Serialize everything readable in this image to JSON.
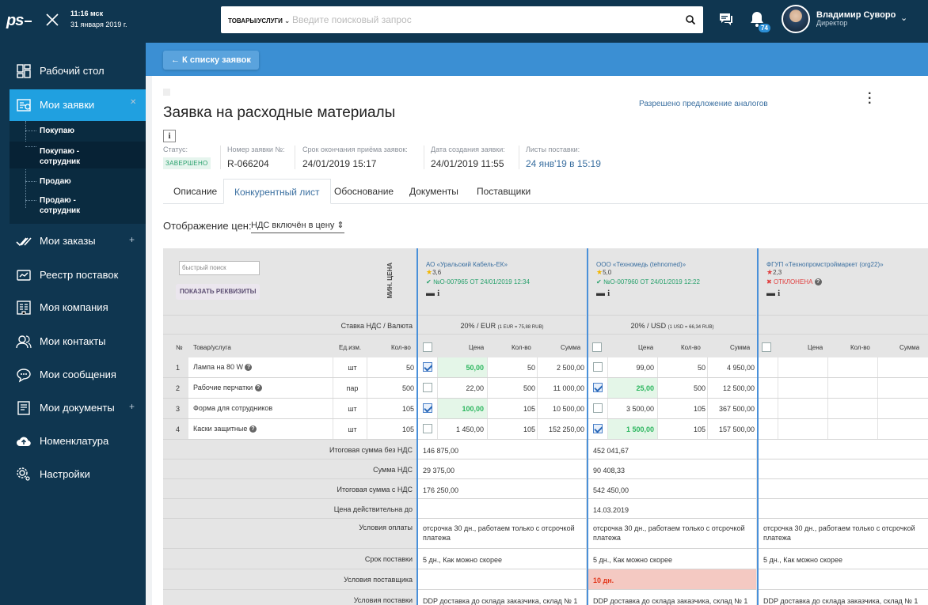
{
  "topbar": {
    "logo": "ps",
    "time": "11:16 мск",
    "date": "31 января 2019 г.",
    "search_category": "ТОВАРЫ/УСЛУГИ",
    "search_placeholder": "Введите поисковый запрос",
    "notif_count": "74",
    "user_name": "Владимир Суворов",
    "user_role": "Директор"
  },
  "sidebar": {
    "items": [
      {
        "label": "Рабочий стол",
        "icon": "dashboard-icon"
      },
      {
        "label": "Мои заявки",
        "icon": "requests-icon",
        "active": true
      },
      {
        "label": "Мои заказы",
        "icon": "orders-icon"
      },
      {
        "label": "Реестр поставок",
        "icon": "registry-icon"
      },
      {
        "label": "Моя компания",
        "icon": "company-icon"
      },
      {
        "label": "Мои контакты",
        "icon": "contacts-icon"
      },
      {
        "label": "Мои сообщения",
        "icon": "messages-icon"
      },
      {
        "label": "Мои документы",
        "icon": "documents-icon"
      },
      {
        "label": "Номенклатура",
        "icon": "cloud-upload-icon"
      },
      {
        "label": "Настройки",
        "icon": "settings-icon"
      }
    ],
    "subitems": [
      "Покупаю",
      "Покупаю -\nсотрудник",
      "Продаю",
      "Продаю -\nсотрудник"
    ]
  },
  "back_label": "← К списку заявок",
  "page": {
    "title": "Заявка на расходные материалы",
    "analogs": "Разрешено предложение аналогов",
    "info_btn": "i",
    "status_label": "Статус:",
    "status_value": "ЗАВЕРШЕНО",
    "number_label": "Номер заявки №:",
    "number_value": "R-066204",
    "deadline_label": "Срок окончания приёма заявок:",
    "deadline_value": "24/01/2019 15:17",
    "created_label": "Дата создания заявки:",
    "created_value": "24/01/2019 11:55",
    "sheets_label": "Листы поставки:",
    "sheets_value": "24 янв'19 в 15:19"
  },
  "tabs": [
    "Описание",
    "Конкурентный лист",
    "Обоснование",
    "Документы",
    "Поставщики"
  ],
  "price_display_label": "Отображение цен:",
  "price_display_value": "НДС включён в цену ⇕",
  "table": {
    "quick_search_placeholder": "быстрый поиск",
    "show_details": "ПОКАЗАТЬ РЕКВИЗИТЫ",
    "min_price_label": "МИН. ЦЕНА",
    "vat_currency_label": "Ставка НДС / Валюта",
    "headers": {
      "num": "№",
      "product": "Товар/услуга",
      "unit": "Ед.изм.",
      "qty": "Кол-во",
      "price": "Цена",
      "sum": "Сумма"
    },
    "suppliers": [
      {
        "name": "АО «Уральский Кабель-ЕК»",
        "rating": "3,6",
        "status": "№О-007965 ОТ 24/01/2019 12:34",
        "status_mark": "✔",
        "vat": "20% / EUR",
        "rate": "(1 EUR = 75,88 RUB)"
      },
      {
        "name": "ООО «Техномедь (tehnomed)»",
        "rating": "5,0",
        "status": "№О-007960 ОТ 24/01/2019 12:22",
        "status_mark": "✔",
        "vat": "20% / USD",
        "rate": "(1 USD = 66,34 RUB)"
      },
      {
        "name": "ФГУП «Технопромстроймаркет (org22)»",
        "rating": "2,3",
        "status": "ОТКЛОНЕНА",
        "status_mark": "✖",
        "vat": "",
        "rate": ""
      }
    ],
    "items": [
      {
        "n": "1",
        "name": "Лампа на 80 W",
        "q": true,
        "unit": "шт",
        "qty": "50",
        "s1": {
          "chk": true,
          "price": "50,00",
          "qty": "50",
          "sum": "2 500,00",
          "best": true
        },
        "s2": {
          "chk": false,
          "price": "99,00",
          "qty": "50",
          "sum": "4 950,00",
          "best": false
        }
      },
      {
        "n": "2",
        "name": "Рабочие перчатки",
        "q": true,
        "unit": "пар",
        "qty": "500",
        "s1": {
          "chk": false,
          "price": "22,00",
          "qty": "500",
          "sum": "11 000,00",
          "best": false
        },
        "s2": {
          "chk": true,
          "price": "25,00",
          "qty": "500",
          "sum": "12 500,00",
          "best": true
        }
      },
      {
        "n": "3",
        "name": "Форма для сотрудников",
        "q": false,
        "unit": "шт",
        "qty": "105",
        "s1": {
          "chk": true,
          "price": "100,00",
          "qty": "105",
          "sum": "10 500,00",
          "best": true
        },
        "s2": {
          "chk": false,
          "price": "3 500,00",
          "qty": "105",
          "sum": "367 500,00",
          "best": false
        }
      },
      {
        "n": "4",
        "name": "Каски защитные",
        "q": true,
        "unit": "шт",
        "qty": "105",
        "s1": {
          "chk": false,
          "price": "1 450,00",
          "qty": "105",
          "sum": "152 250,00",
          "best": false
        },
        "s2": {
          "chk": true,
          "price": "1 500,00",
          "qty": "105",
          "sum": "157 500,00",
          "best": true
        }
      }
    ],
    "summary": [
      {
        "label": "Итоговая сумма без НДС",
        "v1": "146 875,00",
        "v2": "452 041,67",
        "v3": ""
      },
      {
        "label": "Сумма НДС",
        "v1": "29 375,00",
        "v2": "90 408,33",
        "v3": ""
      },
      {
        "label": "Итоговая сумма с НДС",
        "v1": "176 250,00",
        "v2": "542 450,00",
        "v3": ""
      },
      {
        "label": "Цена действительна до",
        "v1": "",
        "v2": "14.03.2019",
        "v3": ""
      },
      {
        "label": "Условия оплаты",
        "v1": "отсрочка 30 дн., работаем только с отсрочкой платежа",
        "v2": "отсрочка 30 дн., работаем только с отсрочкой платежа",
        "v3": "отсрочка 30 дн., работаем только с отсрочкой платежа"
      },
      {
        "label": "Срок поставки",
        "v1": "5 дн., Как можно скорее",
        "v2": "5 дн., Как можно скорее",
        "v3": "5 дн., Как можно скорее"
      },
      {
        "label": "Условия поставщика",
        "v1": "",
        "v2": "10 дн.",
        "v3": ""
      },
      {
        "label": "Условия поставки",
        "v1": "DDP доставка до склада заказчика, склад № 1",
        "v2": "DDP доставка до склада заказчика, склад № 1",
        "v3": "DDP доставка до склада заказчика, склад № 1"
      }
    ]
  },
  "colors": {
    "sidebar": "#0f3650",
    "accent": "#20a0e0",
    "best_price": "#2bb65e",
    "warning": "#e23a1f"
  }
}
